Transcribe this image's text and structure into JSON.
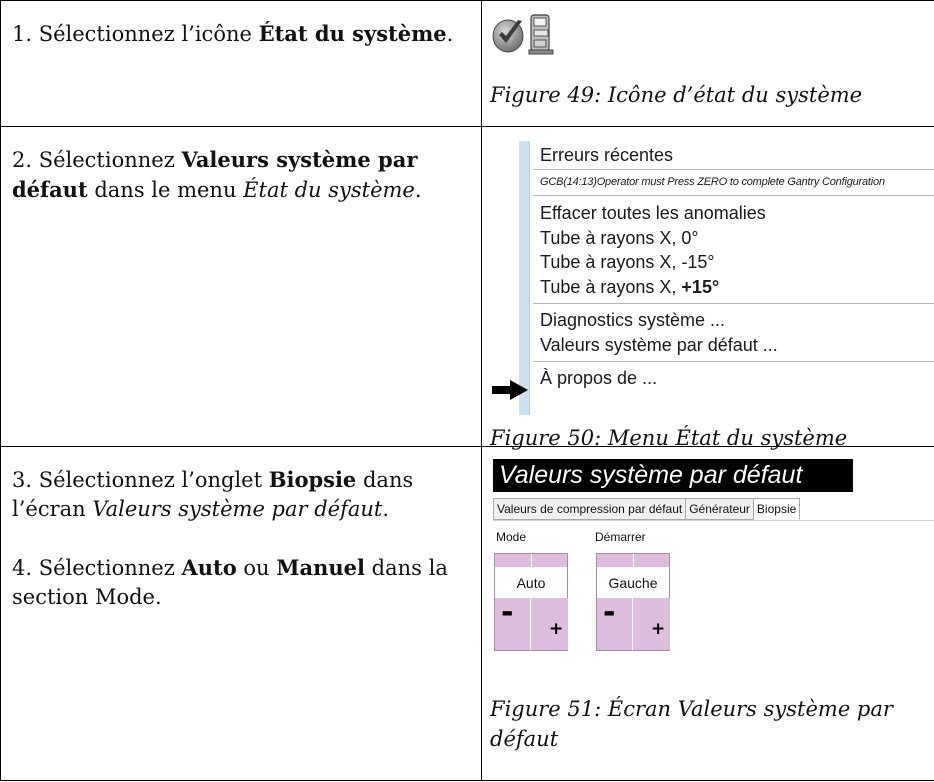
{
  "steps": [
    {
      "n1_prefix": "1. Sélectionnez l’icône ",
      "n1_bold": "État du système",
      "n1_suffix": ".",
      "figure_caption": "Figure 49: Icône d’état du système",
      "icons": [
        "checkmark-shield-icon",
        "gantry-icon"
      ]
    },
    {
      "prefix": "2. Sélectionnez ",
      "bold": "Valeurs système par défaut",
      "middle": " dans le menu ",
      "italic": "État du système",
      "suffix": ".",
      "figure_caption": "Figure 50: Menu État du système"
    },
    {
      "s3_prefix": "3. Sélectionnez l’onglet ",
      "s3_bold": "Biopsie",
      "s3_middle": " dans l’écran ",
      "s3_italic": "Valeurs système par défaut",
      "s3_suffix": ".",
      "s4_prefix": "4. Sélectionnez ",
      "s4_bold1": "Auto",
      "s4_middle": " ou ",
      "s4_bold2": "Manuel",
      "s4_suffix": " dans la section Mode.",
      "figure_caption": "Figure 51: Écran Valeurs système par défaut"
    }
  ],
  "menu": {
    "recent_errors": "Erreurs récentes",
    "error_line": "GCB(14:13)Operator must Press ZERO to complete Gantry Configuration",
    "clear_all": "Effacer toutes les anomalies",
    "tube_0": "Tube à rayons X, 0°",
    "tube_m15": "Tube à rayons X, -15°",
    "tube_p15_prefix": "Tube à rayons X, ",
    "tube_p15_bold": "+15°",
    "diagnostics": "Diagnostics système ...",
    "system_defaults": "Valeurs système par défaut ...",
    "about": "À propos de ..."
  },
  "screen": {
    "title": "Valeurs système par défaut",
    "tabs": [
      "Valeurs de compression par défaut",
      "Générateur",
      "Biopsie"
    ],
    "active_tab": "Biopsie",
    "mode_label": "Mode",
    "start_label": "Démarrer",
    "mode_value": "Auto",
    "start_value": "Gauche",
    "minus": "-",
    "plus": "+"
  }
}
